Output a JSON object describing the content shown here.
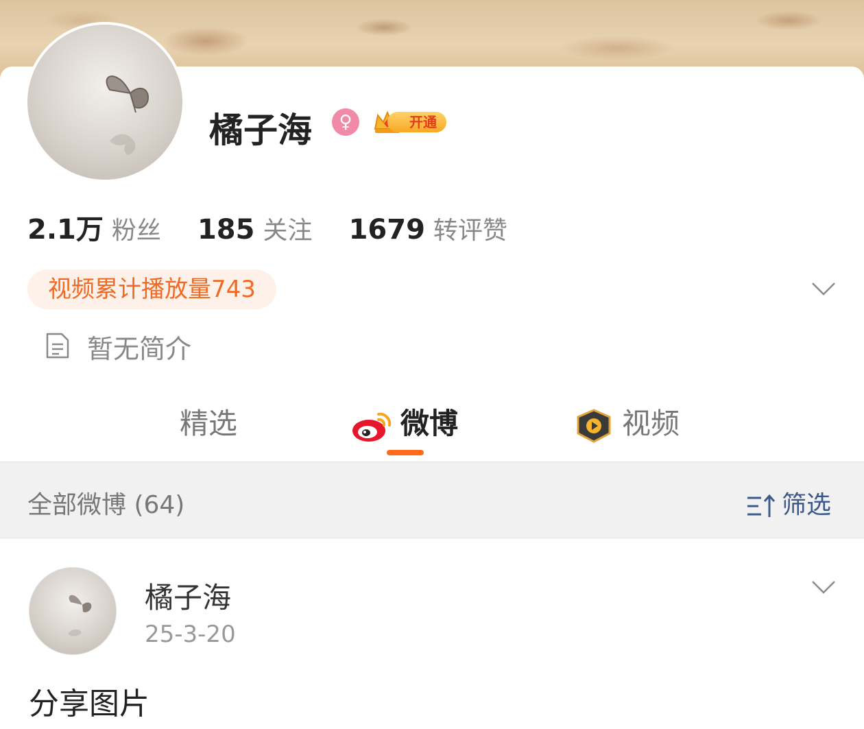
{
  "profile": {
    "username": "橘子海",
    "gender_symbol": "♀",
    "vip_label": "开通",
    "stats": [
      {
        "num": "2.1万",
        "label": "粉丝"
      },
      {
        "num": "185",
        "label": "关注"
      },
      {
        "num": "1679",
        "label": "转评赞"
      }
    ],
    "plays_badge": "视频累计播放量743",
    "bio": "暂无简介"
  },
  "tabs": [
    {
      "label": "精选"
    },
    {
      "label": "微博"
    },
    {
      "label": "视频"
    }
  ],
  "filter_bar": {
    "all_label": "全部微博 (64)",
    "filter_label": "筛选"
  },
  "post": {
    "author": "橘子海",
    "date": "25-3-20",
    "text": "分享图片"
  },
  "colors": {
    "accent": "#ff6a1a",
    "plays_text": "#f06a24",
    "filter_text": "#3b5a8a",
    "gender_badge": "#f08aa8"
  }
}
